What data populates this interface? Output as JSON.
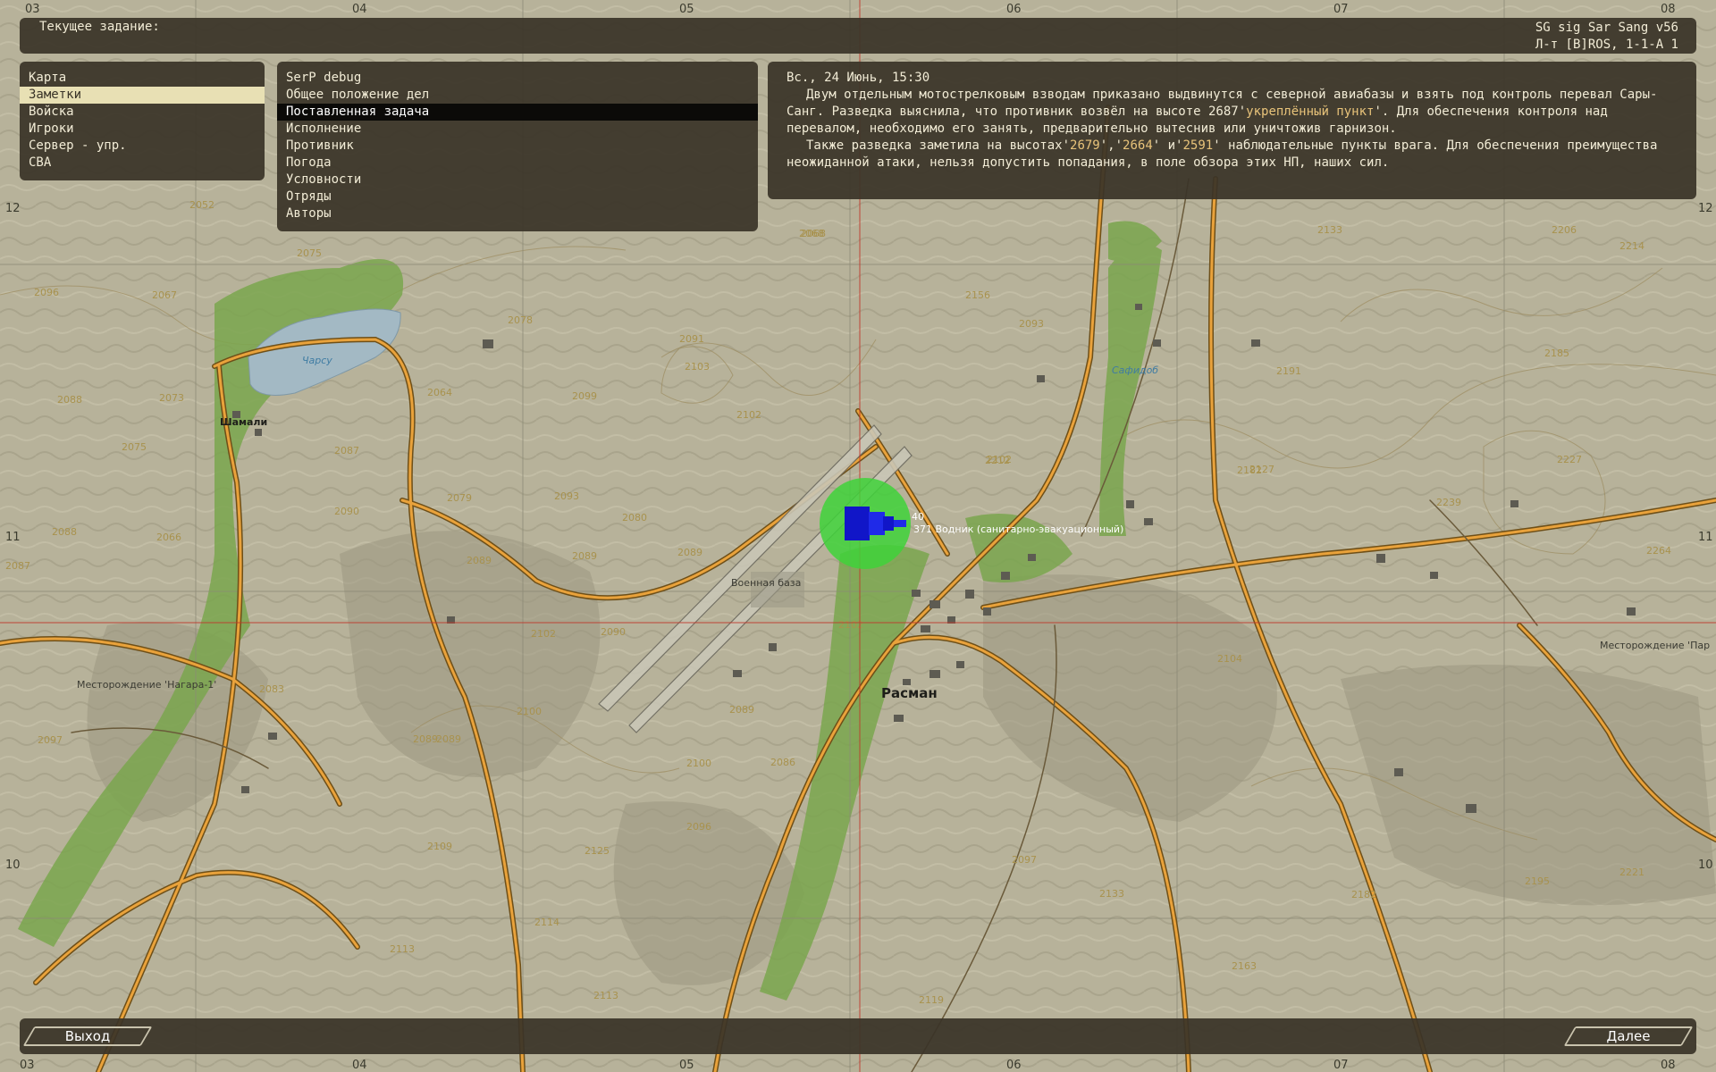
{
  "topbar": {
    "task_label": "Текущее задание:",
    "mission_name": "SG sig Sar Sang v56",
    "player_info": "Л-т [B]ROS, 1-1-A 1"
  },
  "menu": {
    "items": [
      {
        "label": "Карта",
        "selected": false
      },
      {
        "label": "Заметки",
        "selected": true
      },
      {
        "label": "Войска",
        "selected": false
      },
      {
        "label": "Игроки",
        "selected": false
      },
      {
        "label": "Сервер - упр.",
        "selected": false
      },
      {
        "label": "CBA",
        "selected": false
      }
    ]
  },
  "notes": {
    "items": [
      {
        "label": "SerP debug",
        "selected": false
      },
      {
        "label": "Общее положение дел",
        "selected": false
      },
      {
        "label": "Поставленная задача",
        "selected": true
      },
      {
        "label": "Исполнение",
        "selected": false
      },
      {
        "label": "Противник",
        "selected": false
      },
      {
        "label": "Погода",
        "selected": false
      },
      {
        "label": "Условности",
        "selected": false
      },
      {
        "label": "Отряды",
        "selected": false
      },
      {
        "label": "Авторы",
        "selected": false
      }
    ]
  },
  "briefing": {
    "date": "Вс., 24 Июнь,  15:30",
    "p1_a": "Двум отдельным мотострелковым взводам приказано выдвинутся с северной авиабазы и взять под контроль перевал Сары-Санг. Разведка выяснила, что противник возвёл на высоте 2687'",
    "p1_link": "укреплённый пункт",
    "p1_b": "'. Для обеспечения контроля над перевалом, необходимо его занять, предварительно вытеснив или уничтожив гарнизон.",
    "p2_a": "Также разведка заметила на высотах'",
    "p2_h1": "2679",
    "p2_s1": "','",
    "p2_h2": "2664",
    "p2_s2": "' и'",
    "p2_h3": "2591",
    "p2_b": "' наблюдательные пункты врага. Для обеспечения преимущества неожиданной атаки, нельзя допустить попадания, в поле обзора этих НП, наших сил."
  },
  "bottombar": {
    "exit_label": "Выход",
    "next_label": "Далее"
  },
  "map": {
    "grid_top": [
      "03",
      "04",
      "05",
      "06",
      "07",
      "08"
    ],
    "grid_bottom": [
      "03",
      "04",
      "05",
      "06",
      "07",
      "08"
    ],
    "grid_left": [
      "12",
      "11",
      "10"
    ],
    "grid_right": [
      "12",
      "11",
      "10"
    ],
    "places": {
      "town": "Расман",
      "airbase": "Военная база",
      "village_west": "Шамали",
      "lake": "Чарсу",
      "river_label": "Сафидоб",
      "field_west": "Месторождение 'Нагара-1'",
      "field_east": "Месторождение 'Пар"
    },
    "unit_label": "371 Водник (санитарно-эвакуационный)",
    "unit_label_short": "40",
    "elevations": [
      "2052",
      "2075",
      "2096",
      "2067",
      "2064",
      "2088",
      "2073",
      "2075",
      "2087",
      "2090",
      "2088",
      "2066",
      "2087",
      "2089",
      "2078",
      "2079",
      "2093",
      "2089",
      "2099",
      "2102",
      "2090",
      "2091",
      "2103",
      "2102",
      "2068",
      "2156",
      "2093",
      "2102",
      "2080",
      "2089",
      "2102",
      "2100",
      "2089",
      "2086",
      "2100",
      "2096",
      "2125",
      "2113",
      "2119",
      "2097",
      "2163",
      "2133",
      "2206",
      "2214",
      "2185",
      "2227",
      "2239",
      "2264",
      "2195",
      "2221",
      "2104",
      "2212",
      "2182",
      "2068",
      "2097",
      "2083",
      "2089",
      "2089",
      "2113",
      "2114",
      "2109",
      "2133",
      "2127",
      "2191",
      "2182"
    ]
  }
}
